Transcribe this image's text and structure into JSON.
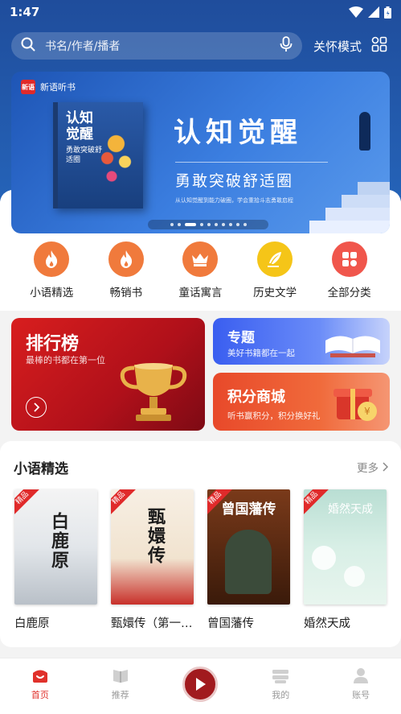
{
  "status_bar": {
    "time": "1:47"
  },
  "search": {
    "placeholder": "书名/作者/播者"
  },
  "header": {
    "care_mode": "关怀模式"
  },
  "banner": {
    "brand": "新语听书",
    "brand_logo_text": "新语",
    "cover_title": "认知觉醒",
    "cover_subtitle": "勇敢突破舒适圈",
    "headline": "认知觉醒",
    "subline": "勇敢突破舒适圈",
    "caption": "从认知觉醒到能力破圈，学会重拾斗志勇敢启程",
    "dot_count": 10,
    "active_dot": 2
  },
  "categories": [
    {
      "label": "小语精选",
      "color": "#f07a3c",
      "icon": "flame-icon"
    },
    {
      "label": "畅销书",
      "color": "#f07a3c",
      "icon": "flame-icon"
    },
    {
      "label": "童话寓言",
      "color": "#f07a3c",
      "icon": "crown-icon"
    },
    {
      "label": "历史文学",
      "color": "#f5c518",
      "icon": "quill-icon"
    },
    {
      "label": "全部分类",
      "color": "#f0564c",
      "icon": "grid-icon"
    }
  ],
  "promos": {
    "ranking": {
      "title": "排行榜",
      "subtitle": "最棒的书都在第一位"
    },
    "topic": {
      "title": "专题",
      "subtitle": "美好书籍都在一起"
    },
    "points": {
      "title": "积分商城",
      "subtitle": "听书赢积分，积分换好礼"
    }
  },
  "section": {
    "title": "小语精选",
    "more": "更多",
    "books": [
      {
        "name": "白鹿原",
        "tag": "精品",
        "cover_text": "白鹿原"
      },
      {
        "name": "甄嬛传（第一部）",
        "tag": "精品",
        "cover_text": "甄嬛传"
      },
      {
        "name": "曾国藩传",
        "tag": "精品",
        "cover_text": "曾国藩传"
      },
      {
        "name": "婚然天成",
        "tag": "精品",
        "cover_text": "婚然天成"
      }
    ]
  },
  "bottom_nav": [
    {
      "label": "首页",
      "active": true
    },
    {
      "label": "推荐",
      "active": false
    },
    {
      "label": "",
      "active": false
    },
    {
      "label": "我的",
      "active": false
    },
    {
      "label": "账号",
      "active": false
    }
  ]
}
